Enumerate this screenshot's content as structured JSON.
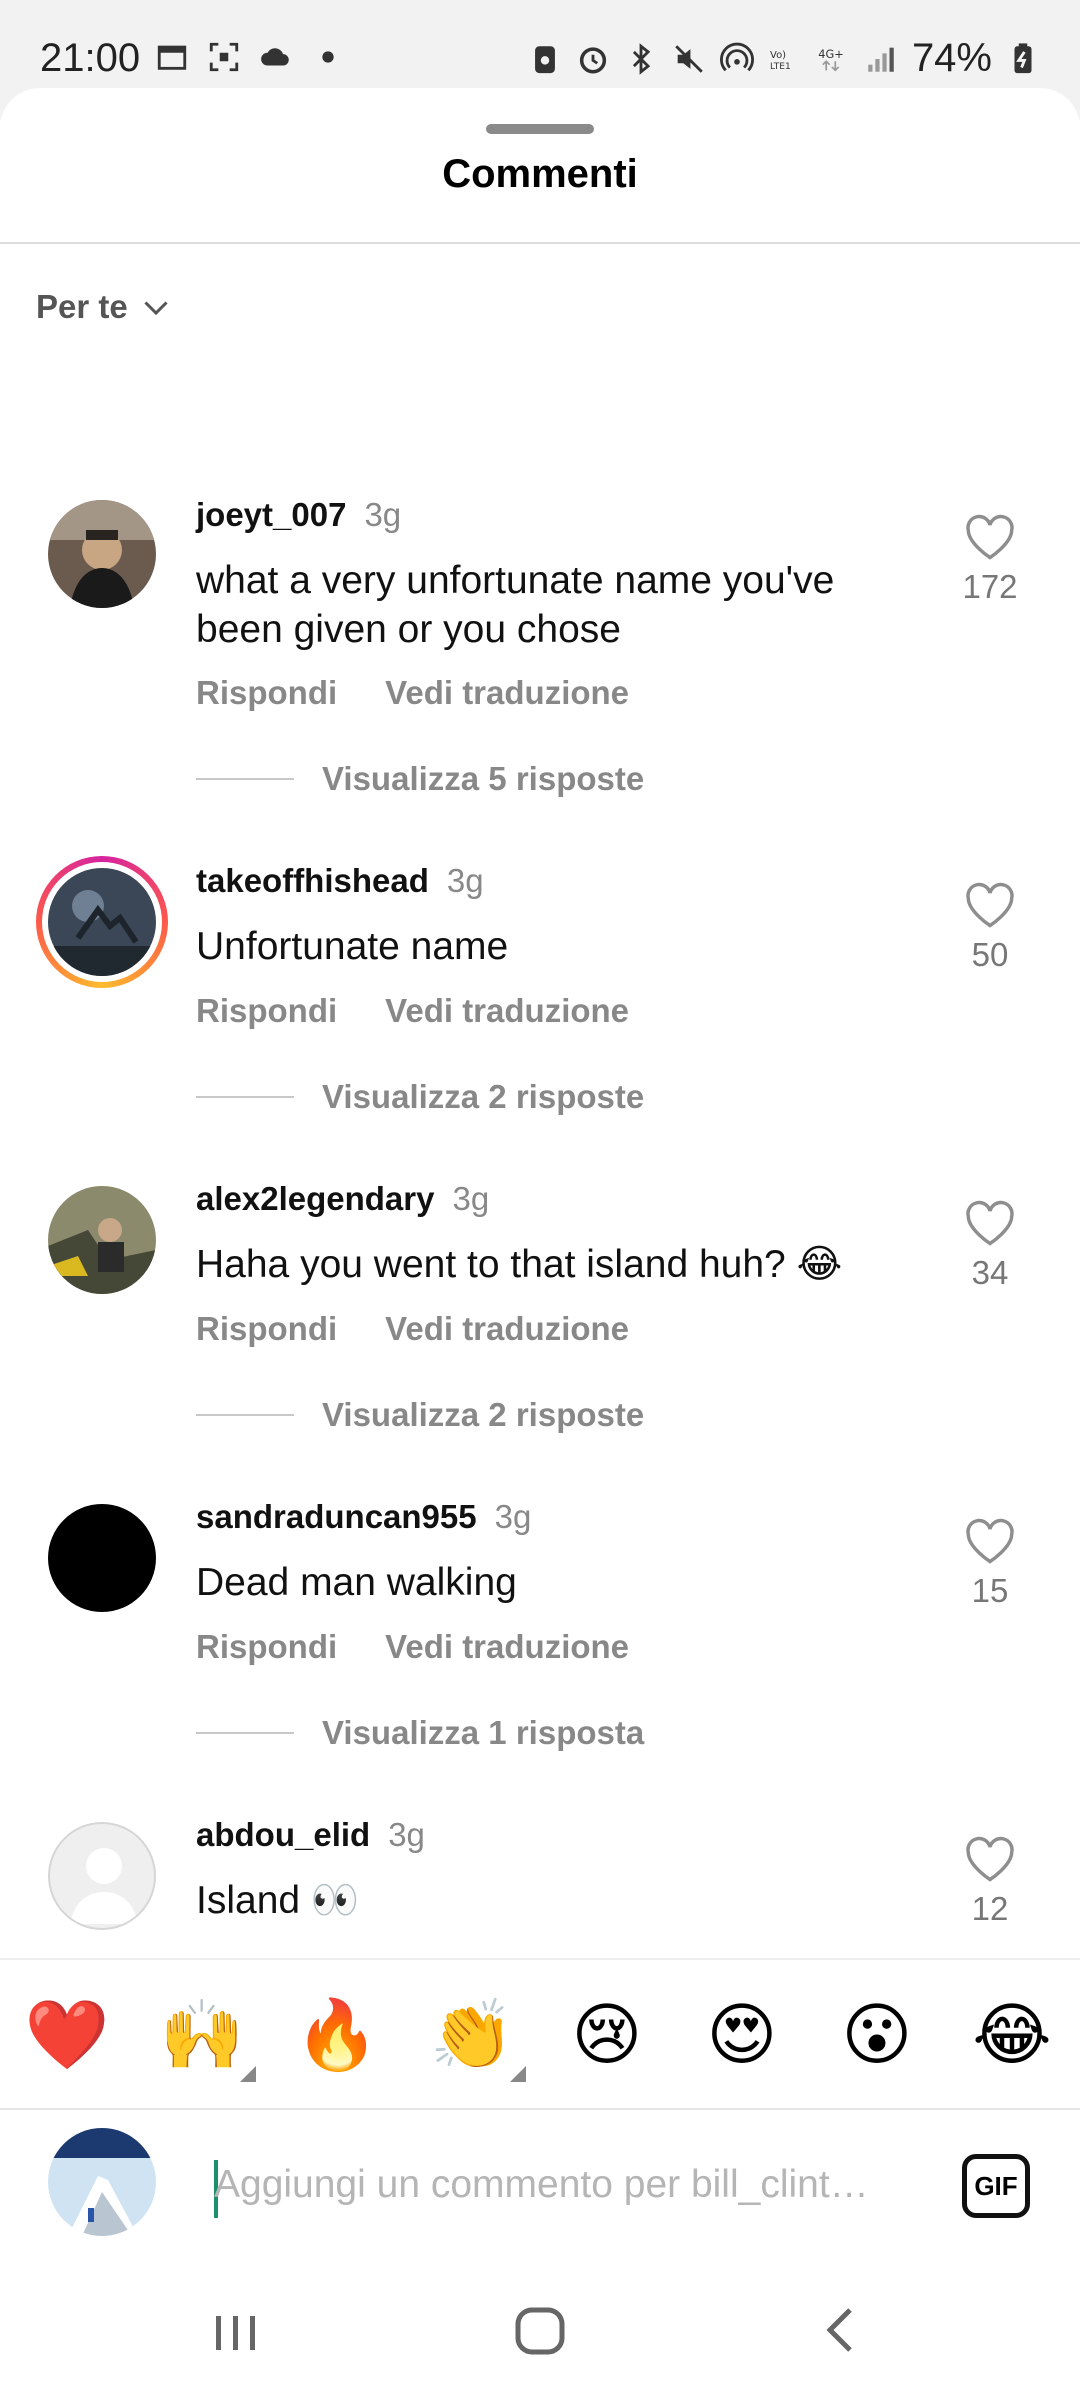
{
  "status_bar": {
    "time": "21:00",
    "battery": "74%"
  },
  "sheet": {
    "title": "Commenti",
    "sort_label": "Per te"
  },
  "comments": [
    {
      "user": "joeyt_007",
      "time": "3g",
      "text_line1": "what a very unfortunate name you've",
      "text_line2": "been given or you chose",
      "reply": "Rispondi",
      "translate": "Vedi traduzione",
      "replies": "Visualizza 5 risposte",
      "likes": "172"
    },
    {
      "user": "takeoffhishead",
      "time": "3g",
      "text_line1": "Unfortunate name",
      "reply": "Rispondi",
      "translate": "Vedi traduzione",
      "replies": "Visualizza 2 risposte",
      "likes": "50"
    },
    {
      "user": "alex2legendary",
      "time": "3g",
      "text_line1": "Haha you went to that island huh? 😂",
      "reply": "Rispondi",
      "translate": "Vedi traduzione",
      "replies": "Visualizza 2 risposte",
      "likes": "34"
    },
    {
      "user": "sandraduncan955",
      "time": "3g",
      "text_line1": "Dead man walking",
      "reply": "Rispondi",
      "translate": "Vedi traduzione",
      "replies": "Visualizza 1 risposta",
      "likes": "15"
    },
    {
      "user": "abdou_elid",
      "time": "3g",
      "text_line1": "Island 👀",
      "likes": "12"
    }
  ],
  "emojis": [
    "❤️",
    "🙌",
    "🔥",
    "👏",
    "😢",
    "😍",
    "😮",
    "😂"
  ],
  "composer": {
    "placeholder": "Aggiungi un commento per bill_clint…",
    "gif_label": "GIF"
  },
  "colors": {
    "like_icon": "#8e8e8e",
    "caret": "#1c8f6a",
    "story_ring_start": "#d6249f",
    "story_ring_end": "#fdbb2d"
  }
}
